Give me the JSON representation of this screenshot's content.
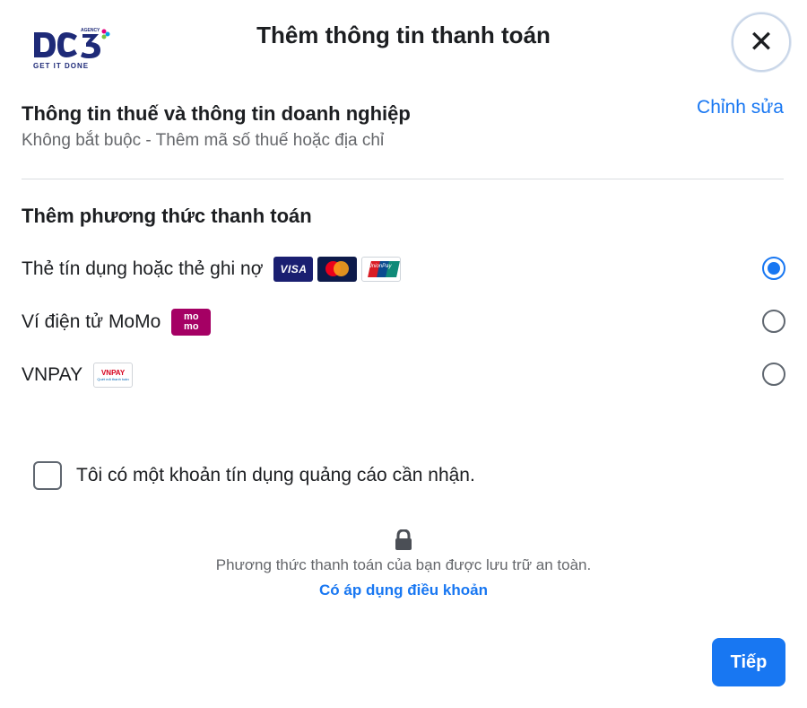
{
  "logo": {
    "main": "DC3",
    "agency": "AGENCY",
    "tagline": "GET IT DONE"
  },
  "dialog": {
    "title": "Thêm thông tin thanh toán"
  },
  "tax": {
    "title": "Thông tin thuế và thông tin doanh nghiệp",
    "subtitle": "Không bắt buộc - Thêm mã số thuế hoặc địa chỉ",
    "edit_label": "Chỉnh sửa"
  },
  "payment": {
    "title": "Thêm phương thức thanh toán",
    "methods": [
      {
        "label": "Thẻ tín dụng hoặc thẻ ghi nợ",
        "selected": true,
        "icons": [
          "visa-logo",
          "mastercard-logo",
          "unionpay-logo"
        ],
        "visa_text": "VISA",
        "unionpay_text": "UnionPay"
      },
      {
        "label": "Ví điện tử MoMo",
        "selected": false,
        "icons": [
          "momo-logo"
        ],
        "momo_text": "mo mo"
      },
      {
        "label": "VNPAY",
        "selected": false,
        "icons": [
          "vnpay-logo"
        ],
        "vnpay_text": "VNPAY",
        "vnpay_sub": "Quét mã thanh toán"
      }
    ]
  },
  "ad_credit": {
    "label": "Tôi có một khoản tín dụng quảng cáo cần nhận.",
    "checked": false
  },
  "security": {
    "icon": "lock-icon",
    "text": "Phương thức thanh toán của bạn được lưu trữ an toàn.",
    "terms_link": "Có áp dụng điều khoản"
  },
  "footer": {
    "next_label": "Tiếp"
  },
  "colors": {
    "accent": "#1877f2",
    "text": "#1c1e21",
    "muted": "#65676b",
    "momo": "#a50064",
    "visa": "#1a1f71"
  }
}
